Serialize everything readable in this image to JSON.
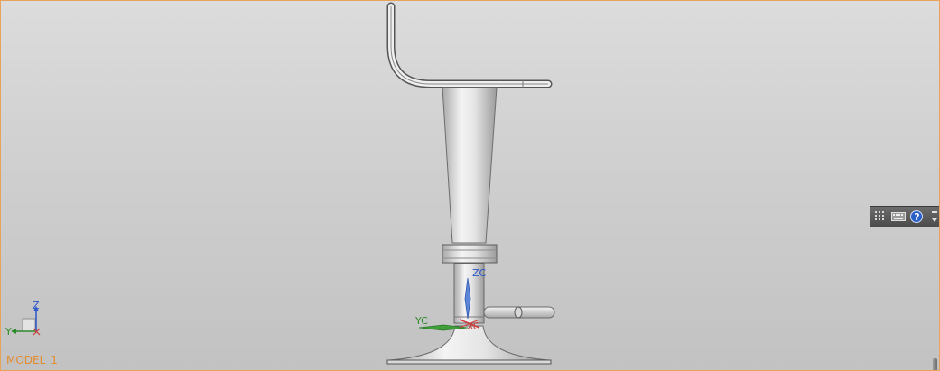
{
  "viewport": {
    "model_name": "MODEL_1",
    "accent_color": "#e38b2f"
  },
  "csys": {
    "zc_label": "ZC",
    "yc_label": "YC",
    "xc_label": "XC"
  },
  "triad": {
    "z_label": "Z",
    "y_label": "Y"
  },
  "toolbar": {
    "icons": [
      "grid-icon",
      "keyboard-icon",
      "help-icon",
      "expand-icon"
    ],
    "help_label": "?"
  }
}
